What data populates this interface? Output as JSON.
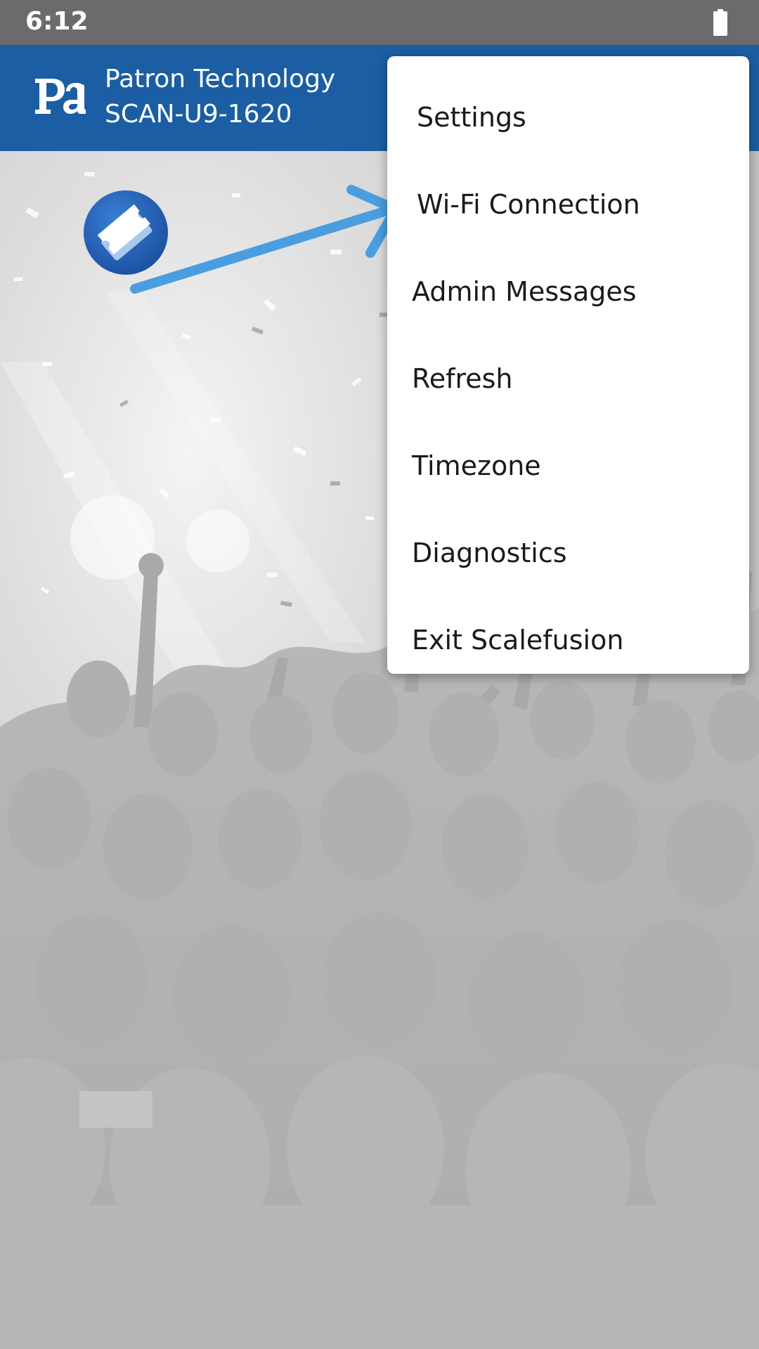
{
  "status_bar": {
    "time": "6:12",
    "battery_icon": "battery-full-icon"
  },
  "app_bar": {
    "logo_icon": "patron-pa-logo",
    "title": "Patron Technology",
    "subtitle": "SCAN-U9-1620",
    "background_color": "#1b5ea3"
  },
  "home": {
    "app_icon": "ticket-icon",
    "annotation": "arrow-icon",
    "arrow_color": "#4a9ee0"
  },
  "menu": {
    "items": [
      {
        "label": "Settings"
      },
      {
        "label": "Wi-Fi Connection"
      },
      {
        "label": "Admin Messages"
      },
      {
        "label": "Refresh"
      },
      {
        "label": "Timezone"
      },
      {
        "label": "Diagnostics"
      },
      {
        "label": "Exit Scalefusion"
      }
    ]
  }
}
